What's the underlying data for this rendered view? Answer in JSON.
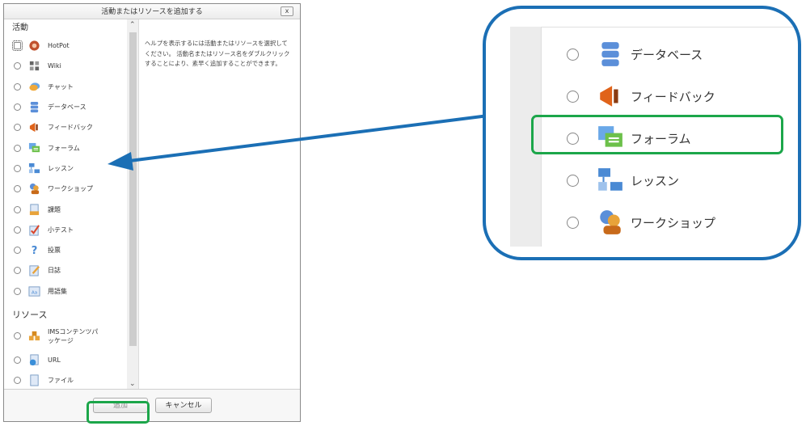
{
  "dialog": {
    "title": "活動またはリソースを追加する",
    "close_label": "x",
    "activities_heading": "活動",
    "resources_heading": "リソース",
    "activities": [
      {
        "label": "HotPot",
        "icon": "hotpot-icon",
        "color": "#c0502c"
      },
      {
        "label": "Wiki",
        "icon": "wiki-icon",
        "color": "#555555"
      },
      {
        "label": "チャット",
        "icon": "chat-icon",
        "color": "#f0a93a"
      },
      {
        "label": "データベース",
        "icon": "database-icon",
        "color": "#5b8fd9"
      },
      {
        "label": "フィードバック",
        "icon": "feedback-icon",
        "color": "#e0631a"
      },
      {
        "label": "フォーラム",
        "icon": "forum-icon",
        "color": "#6cc04a"
      },
      {
        "label": "レッスン",
        "icon": "lesson-icon",
        "color": "#4a8ad4"
      },
      {
        "label": "ワークショップ",
        "icon": "workshop-icon",
        "color": "#e8a33a"
      },
      {
        "label": "課題",
        "icon": "assignment-icon",
        "color": "#5b8fd9"
      },
      {
        "label": "小テスト",
        "icon": "quiz-icon",
        "color": "#d9462b"
      },
      {
        "label": "投票",
        "icon": "choice-icon",
        "color": "#4a8ad4"
      },
      {
        "label": "日誌",
        "icon": "journal-icon",
        "color": "#e8a33a"
      },
      {
        "label": "用語集",
        "icon": "glossary-icon",
        "color": "#4a8ad4"
      }
    ],
    "resources": [
      {
        "label": "IMSコンテンツパッケージ",
        "icon": "ims-package-icon",
        "color": "#e8a33a"
      },
      {
        "label": "URL",
        "icon": "url-icon",
        "color": "#3a8fd9"
      },
      {
        "label": "ファイル",
        "icon": "file-icon",
        "color": "#7a9cc4"
      }
    ],
    "help_text": "ヘルプを表示するには活動またはリソースを選択してください。 活動名またはリソース名をダブルクリックすることにより、素早く追加することができます。",
    "add_button": "追加",
    "cancel_button": "キャンセル"
  },
  "zoom": {
    "items": [
      {
        "label": "データベース",
        "icon": "database-icon"
      },
      {
        "label": "フィードバック",
        "icon": "feedback-icon"
      },
      {
        "label": "フォーラム",
        "icon": "forum-icon"
      },
      {
        "label": "レッスン",
        "icon": "lesson-icon"
      },
      {
        "label": "ワークショップ",
        "icon": "workshop-icon"
      }
    ]
  },
  "colors": {
    "highlight": "#1ca64a",
    "callout": "#1b6fb5"
  }
}
